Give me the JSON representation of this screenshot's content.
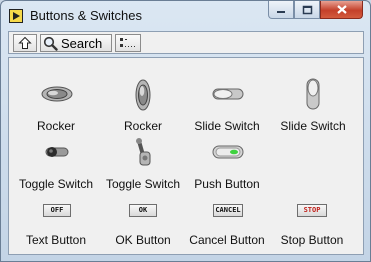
{
  "window": {
    "title": "Buttons & Switches",
    "buttons": [
      "minimize",
      "maximize",
      "close"
    ]
  },
  "toolbar": {
    "up_icon": "up-arrow-icon",
    "search_label": "Search",
    "options_icon": "view-options-icon"
  },
  "palette": {
    "items": [
      {
        "label": "Rocker",
        "icon": "horizontal-rocker-switch-icon"
      },
      {
        "label": "Rocker",
        "icon": "vertical-rocker-switch-icon"
      },
      {
        "label": "Slide Switch",
        "icon": "horizontal-slide-switch-icon"
      },
      {
        "label": "Slide Switch",
        "icon": "vertical-slide-switch-icon"
      },
      {
        "label": "Toggle Switch",
        "icon": "horizontal-toggle-switch-icon"
      },
      {
        "label": "Toggle Switch",
        "icon": "vertical-toggle-switch-icon"
      },
      {
        "label": "Push Button",
        "icon": "push-button-icon"
      },
      {
        "label": "Text Button",
        "button_text": "OFF"
      },
      {
        "label": "OK Button",
        "button_text": "OK"
      },
      {
        "label": "Cancel Button",
        "button_text": "CANCEL"
      },
      {
        "label": "Stop Button",
        "button_text": "STOP"
      }
    ]
  },
  "colors": {
    "stop_text": "#c0201a",
    "push_button_led": "#3fd23f",
    "close_button": "#c4402a"
  }
}
